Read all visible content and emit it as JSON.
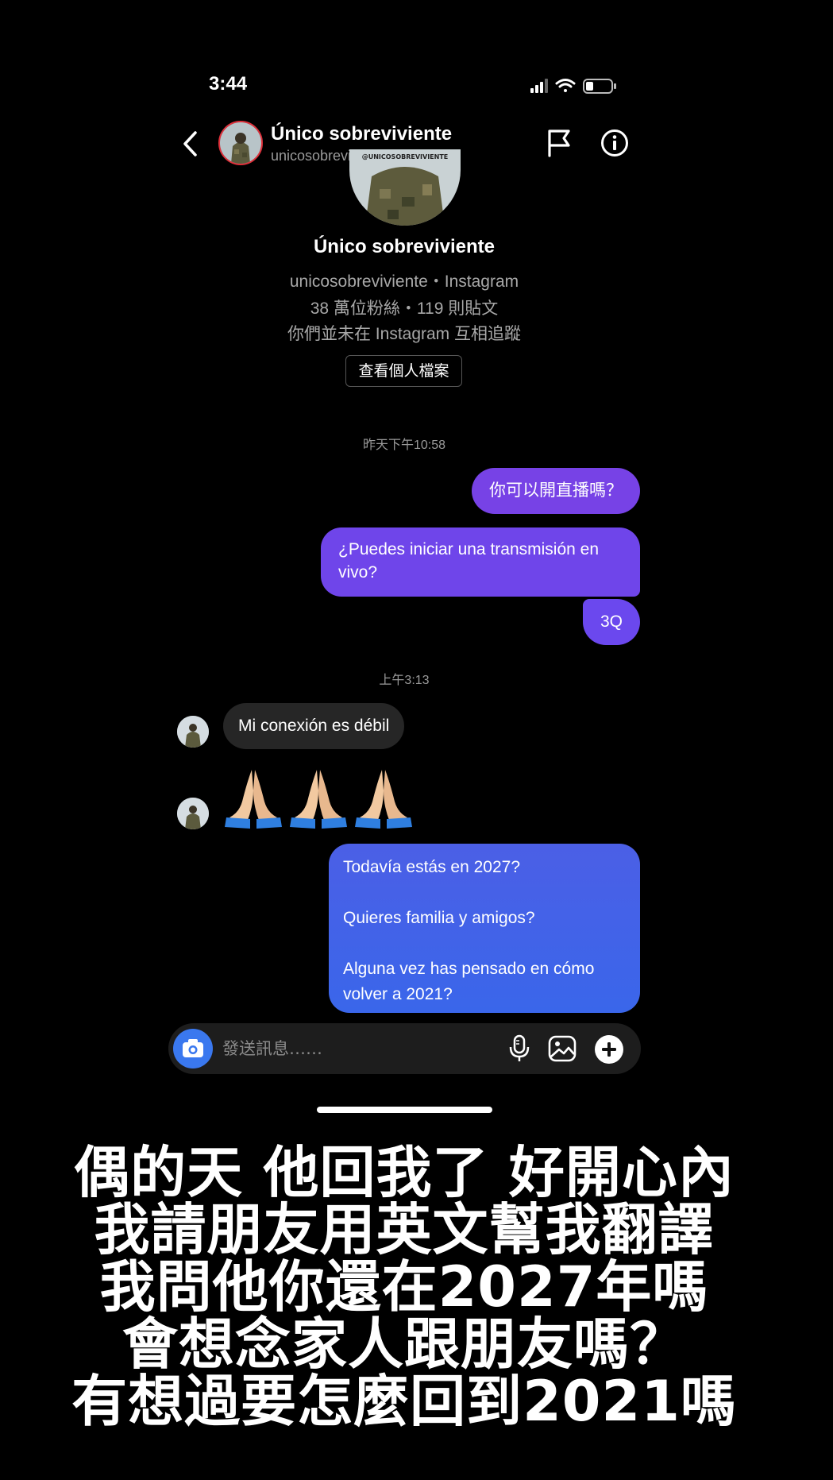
{
  "status_bar": {
    "time": "3:44"
  },
  "header": {
    "name": "Único sobreviviente",
    "handle": "unicosobreviviente"
  },
  "profile": {
    "avatar_watermark": "@UNICOSOBREVIVIENTE",
    "name": "Único sobreviviente",
    "source_line": "unicosobreviviente・Instagram",
    "stats_line": "38 萬位粉絲・119 則貼文",
    "follow_line": "你們並未在 Instagram 互相追蹤",
    "view_profile_label": "查看個人檔案"
  },
  "thread": {
    "timestamp_1": "昨天下午10:58",
    "msg_out_1": "你可以開直播嗎？",
    "msg_out_2": "¿Puedes iniciar una transmisión en vivo?",
    "msg_out_3": "3Q",
    "timestamp_2": "上午3:13",
    "msg_in_1": "Mi conexión es débil",
    "msg_in_2_emoji": "🙏🙏🙏",
    "msg_out_4": "Todavía estás en 2027?\n\nQuieres familia y amigos?\n\nAlguna vez has pensado en cómo volver a 2021?"
  },
  "composer": {
    "placeholder": "發送訊息……"
  },
  "caption": {
    "line1": "偶的天 他回我了 好開心內",
    "line2": "我請朋友用英文幫我翻譯",
    "line3": "我問他你還在2027年嗎",
    "line4": "會想念家人跟朋友嗎？",
    "line5": "有想過要怎麼回到2021嗎"
  },
  "colors": {
    "background": "#000000",
    "outgoing_purple": "#7742e6",
    "outgoing_blue": "#3a66ea",
    "incoming_gray": "#262626",
    "camera_blue": "#3a78ef",
    "avatar_ring": "#e0303a"
  },
  "icons": [
    "back-icon",
    "flag-icon",
    "info-icon",
    "camera-icon",
    "mic-icon",
    "gallery-icon",
    "plus-icon",
    "signal-icon",
    "wifi-icon",
    "battery-icon"
  ]
}
